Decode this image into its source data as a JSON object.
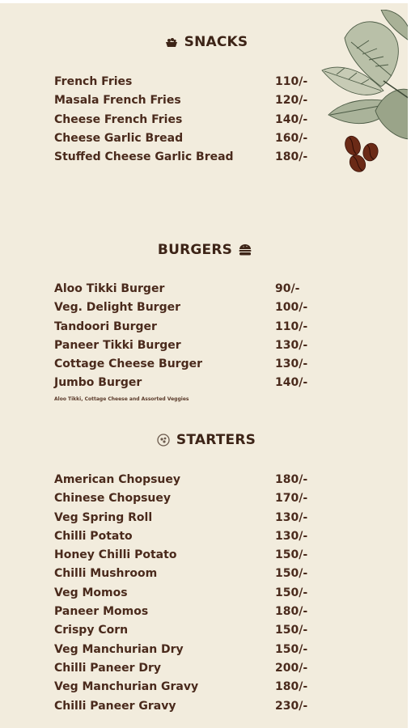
{
  "sections": {
    "snacks": {
      "title": "SNACKS",
      "items": [
        {
          "name": "French Fries",
          "price": "110/-"
        },
        {
          "name": "Masala French Fries",
          "price": "120/-"
        },
        {
          "name": "Cheese French Fries",
          "price": "140/-"
        },
        {
          "name": "Cheese Garlic Bread",
          "price": "160/-"
        },
        {
          "name": "Stuffed Cheese Garlic Bread",
          "price": "180/-"
        }
      ]
    },
    "burgers": {
      "title": "BURGERS",
      "items": [
        {
          "name": "Aloo Tikki Burger",
          "price": "90/-"
        },
        {
          "name": "Veg. Delight Burger",
          "price": "100/-"
        },
        {
          "name": "Tandoori Burger",
          "price": "110/-"
        },
        {
          "name": "Paneer Tikki Burger",
          "price": "130/-"
        },
        {
          "name": "Cottage Cheese Burger",
          "price": "130/-"
        },
        {
          "name": "Jumbo Burger",
          "price": "140/-"
        }
      ],
      "note": "Aloo Tikki, Cottage Cheese and Assorted Veggies"
    },
    "starters": {
      "title": "STARTERS",
      "items": [
        {
          "name": "American Chopsuey",
          "price": "180/-"
        },
        {
          "name": "Chinese Chopsuey",
          "price": "170/-"
        },
        {
          "name": "Veg Spring Roll",
          "price": "130/-"
        },
        {
          "name": "Chilli Potato",
          "price": "130/-"
        },
        {
          "name": "Honey Chilli Potato",
          "price": "150/-"
        },
        {
          "name": "Chilli Mushroom",
          "price": "150/-"
        },
        {
          "name": "Veg Momos",
          "price": "150/-"
        },
        {
          "name": "Paneer Momos",
          "price": "180/-"
        },
        {
          "name": "Crispy Corn",
          "price": "150/-"
        },
        {
          "name": "Veg Manchurian Dry",
          "price": "150/-"
        },
        {
          "name": "Chilli Paneer Dry",
          "price": "200/-"
        },
        {
          "name": "Veg Manchurian Gravy",
          "price": "180/-"
        },
        {
          "name": "Chilli Paneer Gravy",
          "price": "230/-"
        }
      ]
    }
  },
  "icons": {
    "snacks": "snack-bowl-icon",
    "burgers": "burger-icon",
    "starters": "starter-plate-icon",
    "decor": "coffee-leaves-beans-icon"
  },
  "colors": {
    "background": "#f2ecdd",
    "text": "#4a2a1c",
    "heading": "#3d2417"
  }
}
